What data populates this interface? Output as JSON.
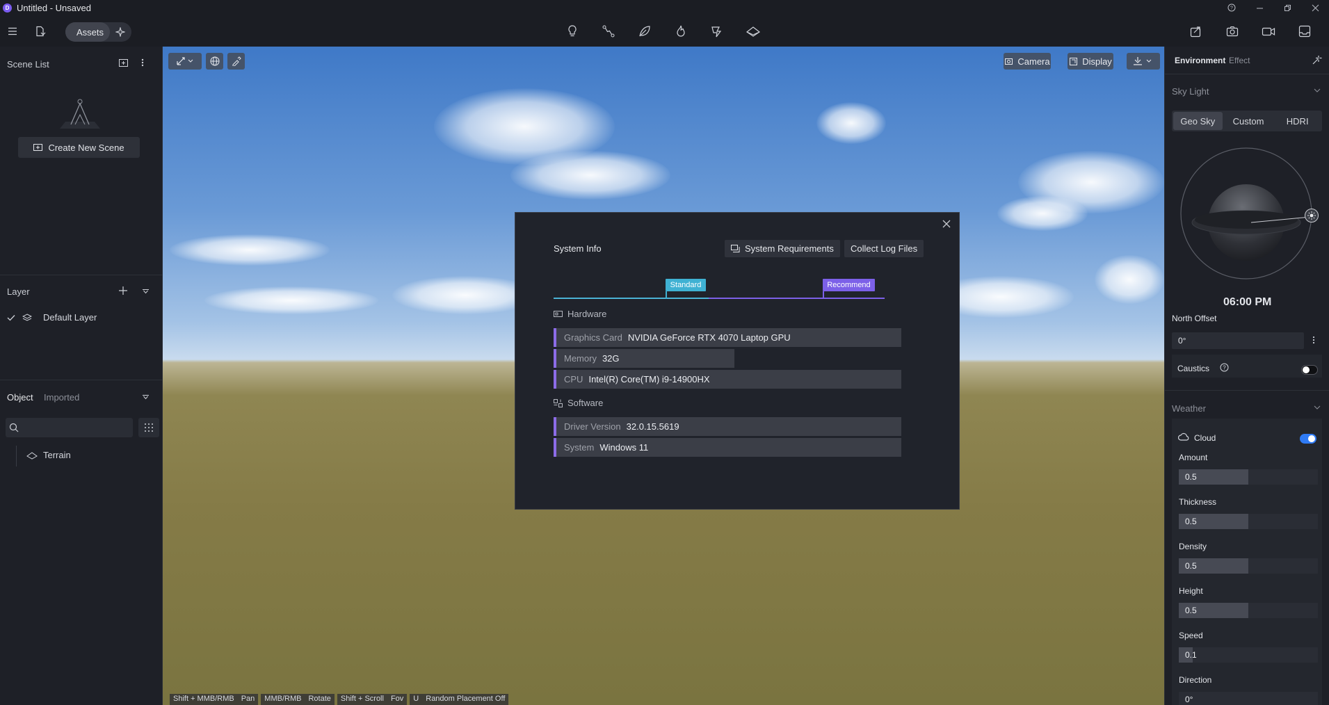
{
  "window": {
    "title": "Untitled - Unsaved",
    "logo_letter": "D"
  },
  "toolbar": {
    "assets_label": "Assets"
  },
  "left_panel": {
    "scene_list_title": "Scene List",
    "create_scene_label": "Create New Scene",
    "layer_title": "Layer",
    "default_layer": "Default Layer",
    "tabs": [
      "Object",
      "Imported"
    ],
    "search_placeholder": "",
    "tree_item": "Terrain"
  },
  "viewport": {
    "camera_label": "Camera",
    "display_label": "Display",
    "hints": [
      {
        "key": "Shift + MMB/RMB",
        "action": "Pan"
      },
      {
        "key": "MMB/RMB",
        "action": "Rotate"
      },
      {
        "key": "Shift + Scroll",
        "action": "Fov"
      },
      {
        "key": "U",
        "action": "Random Placement Off"
      }
    ]
  },
  "modal": {
    "title": "System Info",
    "requirements_label": "System Requirements",
    "collect_logs_label": "Collect Log Files",
    "standard_badge": "Standard",
    "recommend_badge": "Recommend",
    "hardware_title": "Hardware",
    "software_title": "Software",
    "hardware": [
      {
        "key": "Graphics Card",
        "value": "NVIDIA GeForce RTX 4070 Laptop GPU"
      },
      {
        "key": "Memory",
        "value": "32G"
      },
      {
        "key": "CPU",
        "value": "Intel(R) Core(TM) i9-14900HX"
      }
    ],
    "software": [
      {
        "key": "Driver Version",
        "value": "32.0.15.5619"
      },
      {
        "key": "System",
        "value": "Windows 11"
      }
    ]
  },
  "right_panel": {
    "tabs": [
      "Environment",
      "Effect"
    ],
    "sky_light_title": "Sky Light",
    "sky_modes": [
      "Geo Sky",
      "Custom",
      "HDRI"
    ],
    "time": "06:00 PM",
    "north_offset_label": "North Offset",
    "north_offset_value": "0°",
    "caustics_label": "Caustics",
    "caustics_on": false,
    "weather_title": "Weather",
    "cloud_label": "Cloud",
    "cloud_on": true,
    "sliders": [
      {
        "label": "Amount",
        "value": "0.5",
        "fraction": 0.5
      },
      {
        "label": "Thickness",
        "value": "0.5",
        "fraction": 0.5
      },
      {
        "label": "Density",
        "value": "0.5",
        "fraction": 0.5
      },
      {
        "label": "Height",
        "value": "0.5",
        "fraction": 0.5
      },
      {
        "label": "Speed",
        "value": "0.1",
        "fraction": 0.1
      },
      {
        "label": "Direction",
        "value": "0°",
        "fraction": 0.0
      }
    ],
    "accent_color": "#2f7bf5"
  }
}
